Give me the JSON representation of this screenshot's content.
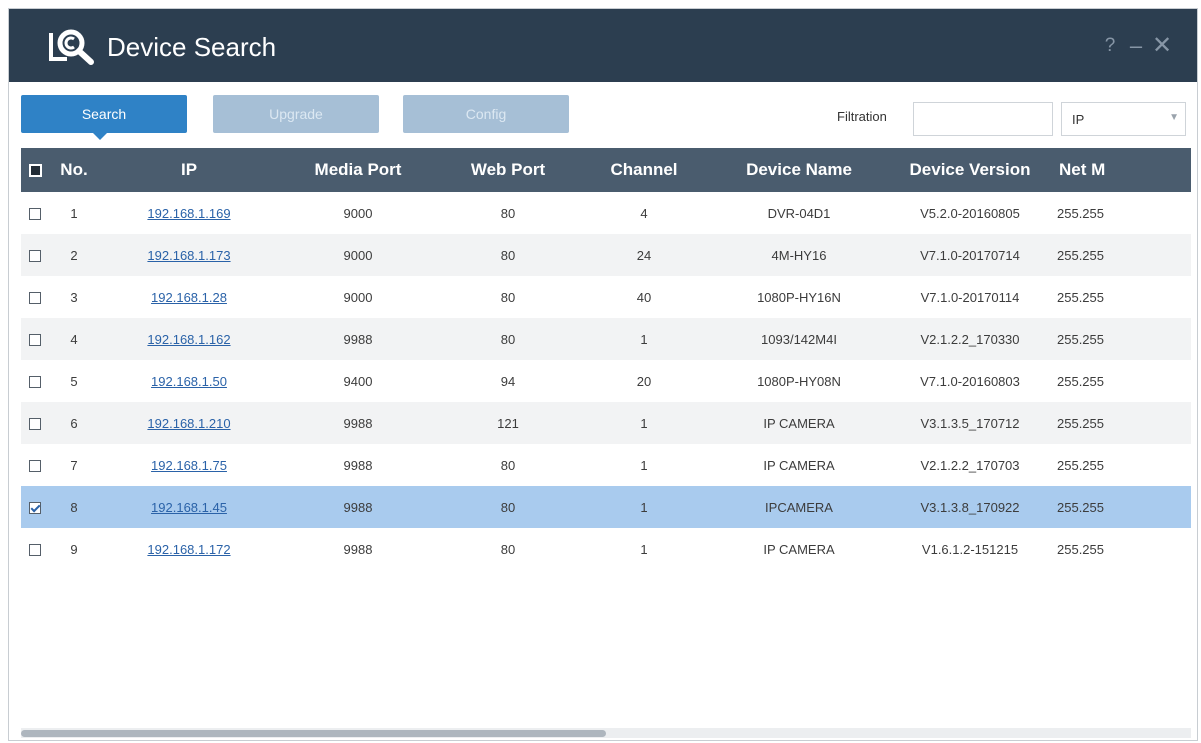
{
  "window": {
    "title": "Device Search",
    "controls": {
      "help": "?",
      "minimize": "–",
      "close": "✕"
    }
  },
  "toolbar": {
    "search_label": "Search",
    "upgrade_label": "Upgrade",
    "config_label": "Config",
    "filtration_label": "Filtration",
    "filtration_value": "",
    "filter_field": "IP"
  },
  "table": {
    "headers": {
      "no": "No.",
      "ip": "IP",
      "media_port": "Media Port",
      "web_port": "Web Port",
      "channel": "Channel",
      "device_name": "Device Name",
      "device_version": "Device Version",
      "net_mask": "Net M"
    },
    "rows": [
      {
        "no": "1",
        "ip": "192.168.1.169",
        "media_port": "9000",
        "web_port": "80",
        "channel": "4",
        "device_name": "DVR-04D1",
        "device_version": "V5.2.0-20160805",
        "net_mask": "255.255",
        "checked": false
      },
      {
        "no": "2",
        "ip": "192.168.1.173",
        "media_port": "9000",
        "web_port": "80",
        "channel": "24",
        "device_name": "4M-HY16",
        "device_version": "V7.1.0-20170714",
        "net_mask": "255.255",
        "checked": false
      },
      {
        "no": "3",
        "ip": "192.168.1.28",
        "media_port": "9000",
        "web_port": "80",
        "channel": "40",
        "device_name": "1080P-HY16N",
        "device_version": "V7.1.0-20170114",
        "net_mask": "255.255",
        "checked": false
      },
      {
        "no": "4",
        "ip": "192.168.1.162",
        "media_port": "9988",
        "web_port": "80",
        "channel": "1",
        "device_name": "1093/142M4I",
        "device_version": "V2.1.2.2_170330",
        "net_mask": "255.255",
        "checked": false
      },
      {
        "no": "5",
        "ip": "192.168.1.50",
        "media_port": "9400",
        "web_port": "94",
        "channel": "20",
        "device_name": "1080P-HY08N",
        "device_version": "V7.1.0-20160803",
        "net_mask": "255.255",
        "checked": false
      },
      {
        "no": "6",
        "ip": "192.168.1.210",
        "media_port": "9988",
        "web_port": "121",
        "channel": "1",
        "device_name": "IP CAMERA",
        "device_version": "V3.1.3.5_170712",
        "net_mask": "255.255",
        "checked": false
      },
      {
        "no": "7",
        "ip": "192.168.1.75",
        "media_port": "9988",
        "web_port": "80",
        "channel": "1",
        "device_name": "IP CAMERA",
        "device_version": "V2.1.2.2_170703",
        "net_mask": "255.255",
        "checked": false
      },
      {
        "no": "8",
        "ip": "192.168.1.45",
        "media_port": "9988",
        "web_port": "80",
        "channel": "1",
        "device_name": "IPCAMERA",
        "device_version": "V3.1.3.8_170922",
        "net_mask": "255.255",
        "checked": true
      },
      {
        "no": "9",
        "ip": "192.168.1.172",
        "media_port": "9988",
        "web_port": "80",
        "channel": "1",
        "device_name": "IP CAMERA",
        "device_version": "V1.6.1.2-151215",
        "net_mask": "255.255",
        "checked": false
      }
    ]
  },
  "selected_row": "8",
  "scroll": {
    "horizontal_position": 0,
    "visible_fraction": 0.5
  },
  "icons": {
    "app_logo": "device-search-camera-magnifier-icon",
    "select_arrow": "chevron-down-icon"
  },
  "colors": {
    "titlebar": "#2c3e50",
    "header": "#4a5c6e",
    "primary_button": "#2f82c6",
    "disabled_button": "#a6bfd6",
    "selected_row": "#a9cbee",
    "link": "#2a62a8"
  }
}
